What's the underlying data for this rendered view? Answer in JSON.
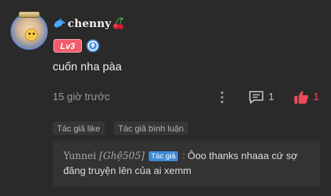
{
  "comment": {
    "username": "chenny",
    "level": "Lv3",
    "text": "cuốn nha pàa",
    "timestamp": "15 giờ trước",
    "reply_count": "1",
    "like_count": "1"
  },
  "tags": {
    "author_liked": "Tác giả like",
    "author_replied": "Tác giả bình luận"
  },
  "reply": {
    "name_prefix": "Yunnei ",
    "name_suffix": "[Ghệ505]",
    "author_label": "Tác giả",
    "separator": ":",
    "text": "Ôoo thanks nhaaa cứ sợ đăng truyện lên của ai xemm"
  },
  "colors": {
    "background": "#2a2a2a",
    "level_badge": "#f25c6b",
    "like_accent": "#ec4a5c",
    "author_chip": "#3d8bd9",
    "verify_badge": "#4a90e2"
  },
  "icons": [
    "dolphin-icon",
    "cherry-icon",
    "verified-badge-icon",
    "more-vertical-icon",
    "reply-icon",
    "thumbs-up-icon"
  ]
}
